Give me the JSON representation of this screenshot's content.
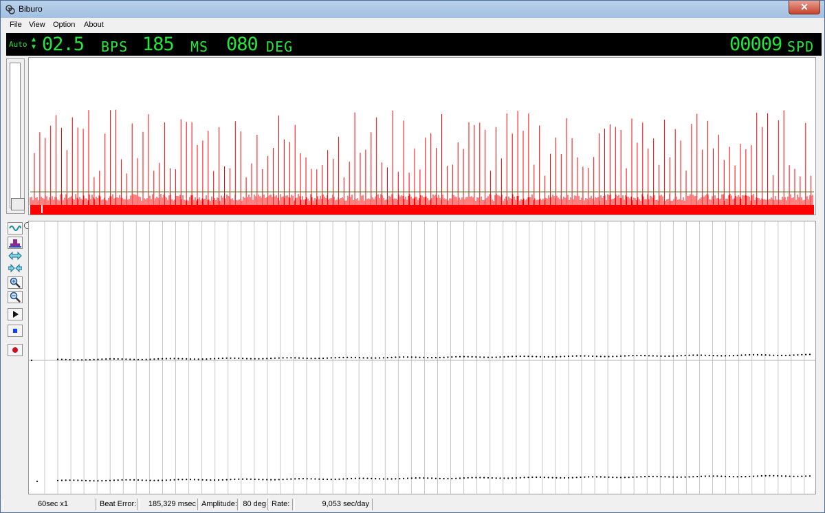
{
  "window": {
    "title": "Biburo",
    "close_glyph": "✕"
  },
  "menu": [
    "File",
    "View",
    "Option",
    "About"
  ],
  "display": {
    "mode": "Auto",
    "bps_value": "02.5",
    "bps_unit": "BPS",
    "ms_value": "185",
    "ms_unit": "MS",
    "deg_value": "080",
    "deg_unit": "DEG",
    "spd_value": "00009",
    "spd_unit": "SPD"
  },
  "toolbar_icons": [
    "wave-icon",
    "weight-icon",
    "stretch-icon",
    "shrink-icon",
    "zoom-in-icon",
    "zoom-out-icon",
    "play-icon",
    "stop-icon",
    "record-icon"
  ],
  "status": {
    "timebase": "60sec x1",
    "beat_error_label": "Beat Error:",
    "beat_error_value": "185,329 msec",
    "amplitude_label": "Amplitude:",
    "amplitude_value": "80 deg",
    "rate_label": "Rate:",
    "rate_value": "9,053 sec/day"
  },
  "colors": {
    "lcd_text": "#22e63a",
    "waveform": "#ff0000",
    "threshold": "#4f7a2a",
    "dots": "#000000"
  }
}
